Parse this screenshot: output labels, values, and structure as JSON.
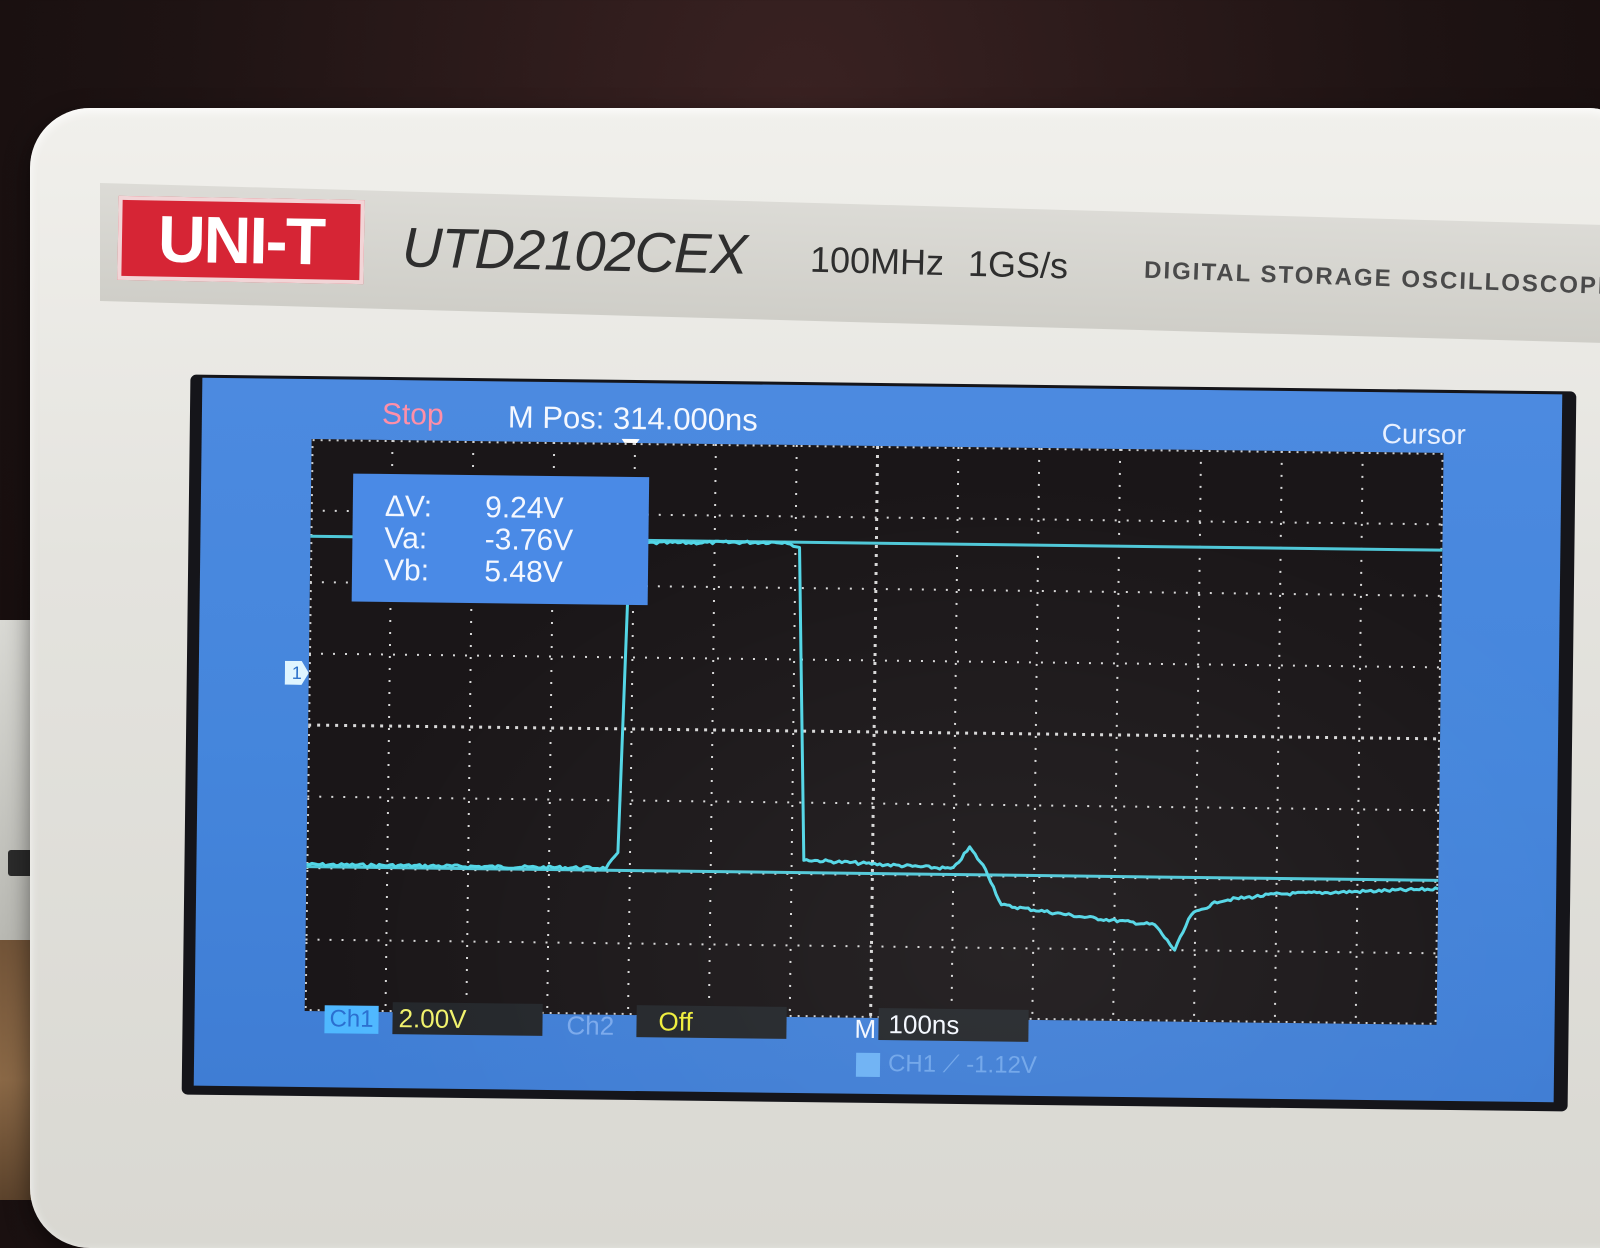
{
  "device": {
    "brand": "UNI-T",
    "model": "UTD2102CEX",
    "bandwidth": "100MHz",
    "sample_rate": "1GS/s",
    "subtitle": "DIGITAL STORAGE OSCILLOSCOPE"
  },
  "screen": {
    "status": "Stop",
    "m_pos": "M Pos: 314.000ns",
    "menu_title": "Cursor",
    "readout": {
      "delta_v_label": "ΔV:",
      "delta_v_value": "9.24V",
      "va_label": "Va:",
      "va_value": "-3.76V",
      "vb_label": "Vb:",
      "vb_value": "5.48V"
    },
    "channel_marker": "1",
    "bottom": {
      "ch1_label": "Ch1",
      "ch1_scale": "2.00V",
      "ch2_label": "Ch2",
      "ch2_state": "Off",
      "m_label": "M",
      "timebase": "100ns",
      "trigger_text": "CH1 ⟋ -1.12V"
    },
    "colors": {
      "screen_bg": "#4586dc",
      "grid_bg": "#1a1618",
      "trace": "#52d6e6",
      "cursor_line": "#4fc8d8",
      "stop": "#ff8fa8"
    }
  },
  "chart_data": {
    "type": "line",
    "x_divisions": 14,
    "y_divisions": 8,
    "series": [
      {
        "x": [
          0,
          3.7,
          3.85,
          3.95,
          5.9,
          6.05,
          6.15,
          8.0,
          8.2,
          8.4,
          8.6,
          9.6,
          10.5,
          10.75,
          10.95,
          11.3,
          12.0,
          13.0,
          14.0
        ],
        "y": [
          -3.7,
          -3.7,
          -3.3,
          5.4,
          5.48,
          5.3,
          -3.4,
          -3.6,
          -3.0,
          -3.6,
          -4.6,
          -4.9,
          -5.1,
          -5.8,
          -4.8,
          -4.4,
          -4.2,
          -4.1,
          -4.0
        ]
      }
    ],
    "cursors": {
      "vb": 5.48,
      "va": -3.76
    }
  }
}
